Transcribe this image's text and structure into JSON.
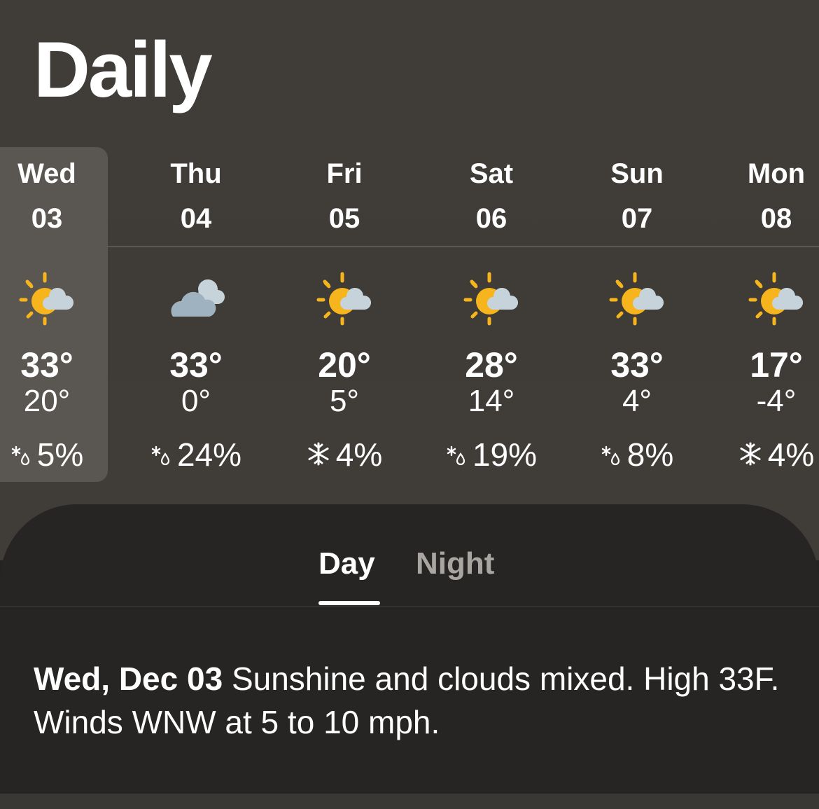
{
  "title": "Daily",
  "colors": {
    "background": "#403d39",
    "selected_column": "#5a5651",
    "sheet": "#262524",
    "sun": "#f6b51c",
    "cloud": "#9fb2bf",
    "cloud_light": "#c7d3da",
    "inactive_tab": "#a9a6a1"
  },
  "days": [
    {
      "name": "Wed",
      "date": "03",
      "icon": "partly-sunny-icon",
      "high": "33°",
      "low": "20°",
      "precip_icon": "snow-rain-icon",
      "precip": "5%",
      "selected": true
    },
    {
      "name": "Thu",
      "date": "04",
      "icon": "cloudy-icon",
      "high": "33°",
      "low": "0°",
      "precip_icon": "snow-rain-icon",
      "precip": "24%",
      "selected": false
    },
    {
      "name": "Fri",
      "date": "05",
      "icon": "partly-sunny-icon",
      "high": "20°",
      "low": "5°",
      "precip_icon": "snowflake-icon",
      "precip": "4%",
      "selected": false
    },
    {
      "name": "Sat",
      "date": "06",
      "icon": "partly-sunny-icon",
      "high": "28°",
      "low": "14°",
      "precip_icon": "snow-rain-icon",
      "precip": "19%",
      "selected": false
    },
    {
      "name": "Sun",
      "date": "07",
      "icon": "partly-sunny-icon",
      "high": "33°",
      "low": "4°",
      "precip_icon": "snow-rain-icon",
      "precip": "8%",
      "selected": false
    },
    {
      "name": "Mon",
      "date": "08",
      "icon": "partly-sunny-icon",
      "high": "17°",
      "low": "-4°",
      "precip_icon": "snowflake-icon",
      "precip": "4%",
      "selected": false
    }
  ],
  "tabs": {
    "day": "Day",
    "night": "Night",
    "active": "day"
  },
  "summary": {
    "date": "Wed, Dec 03",
    "text": "Sunshine and clouds mixed. High 33F. Winds WNW at 5 to 10 mph."
  }
}
